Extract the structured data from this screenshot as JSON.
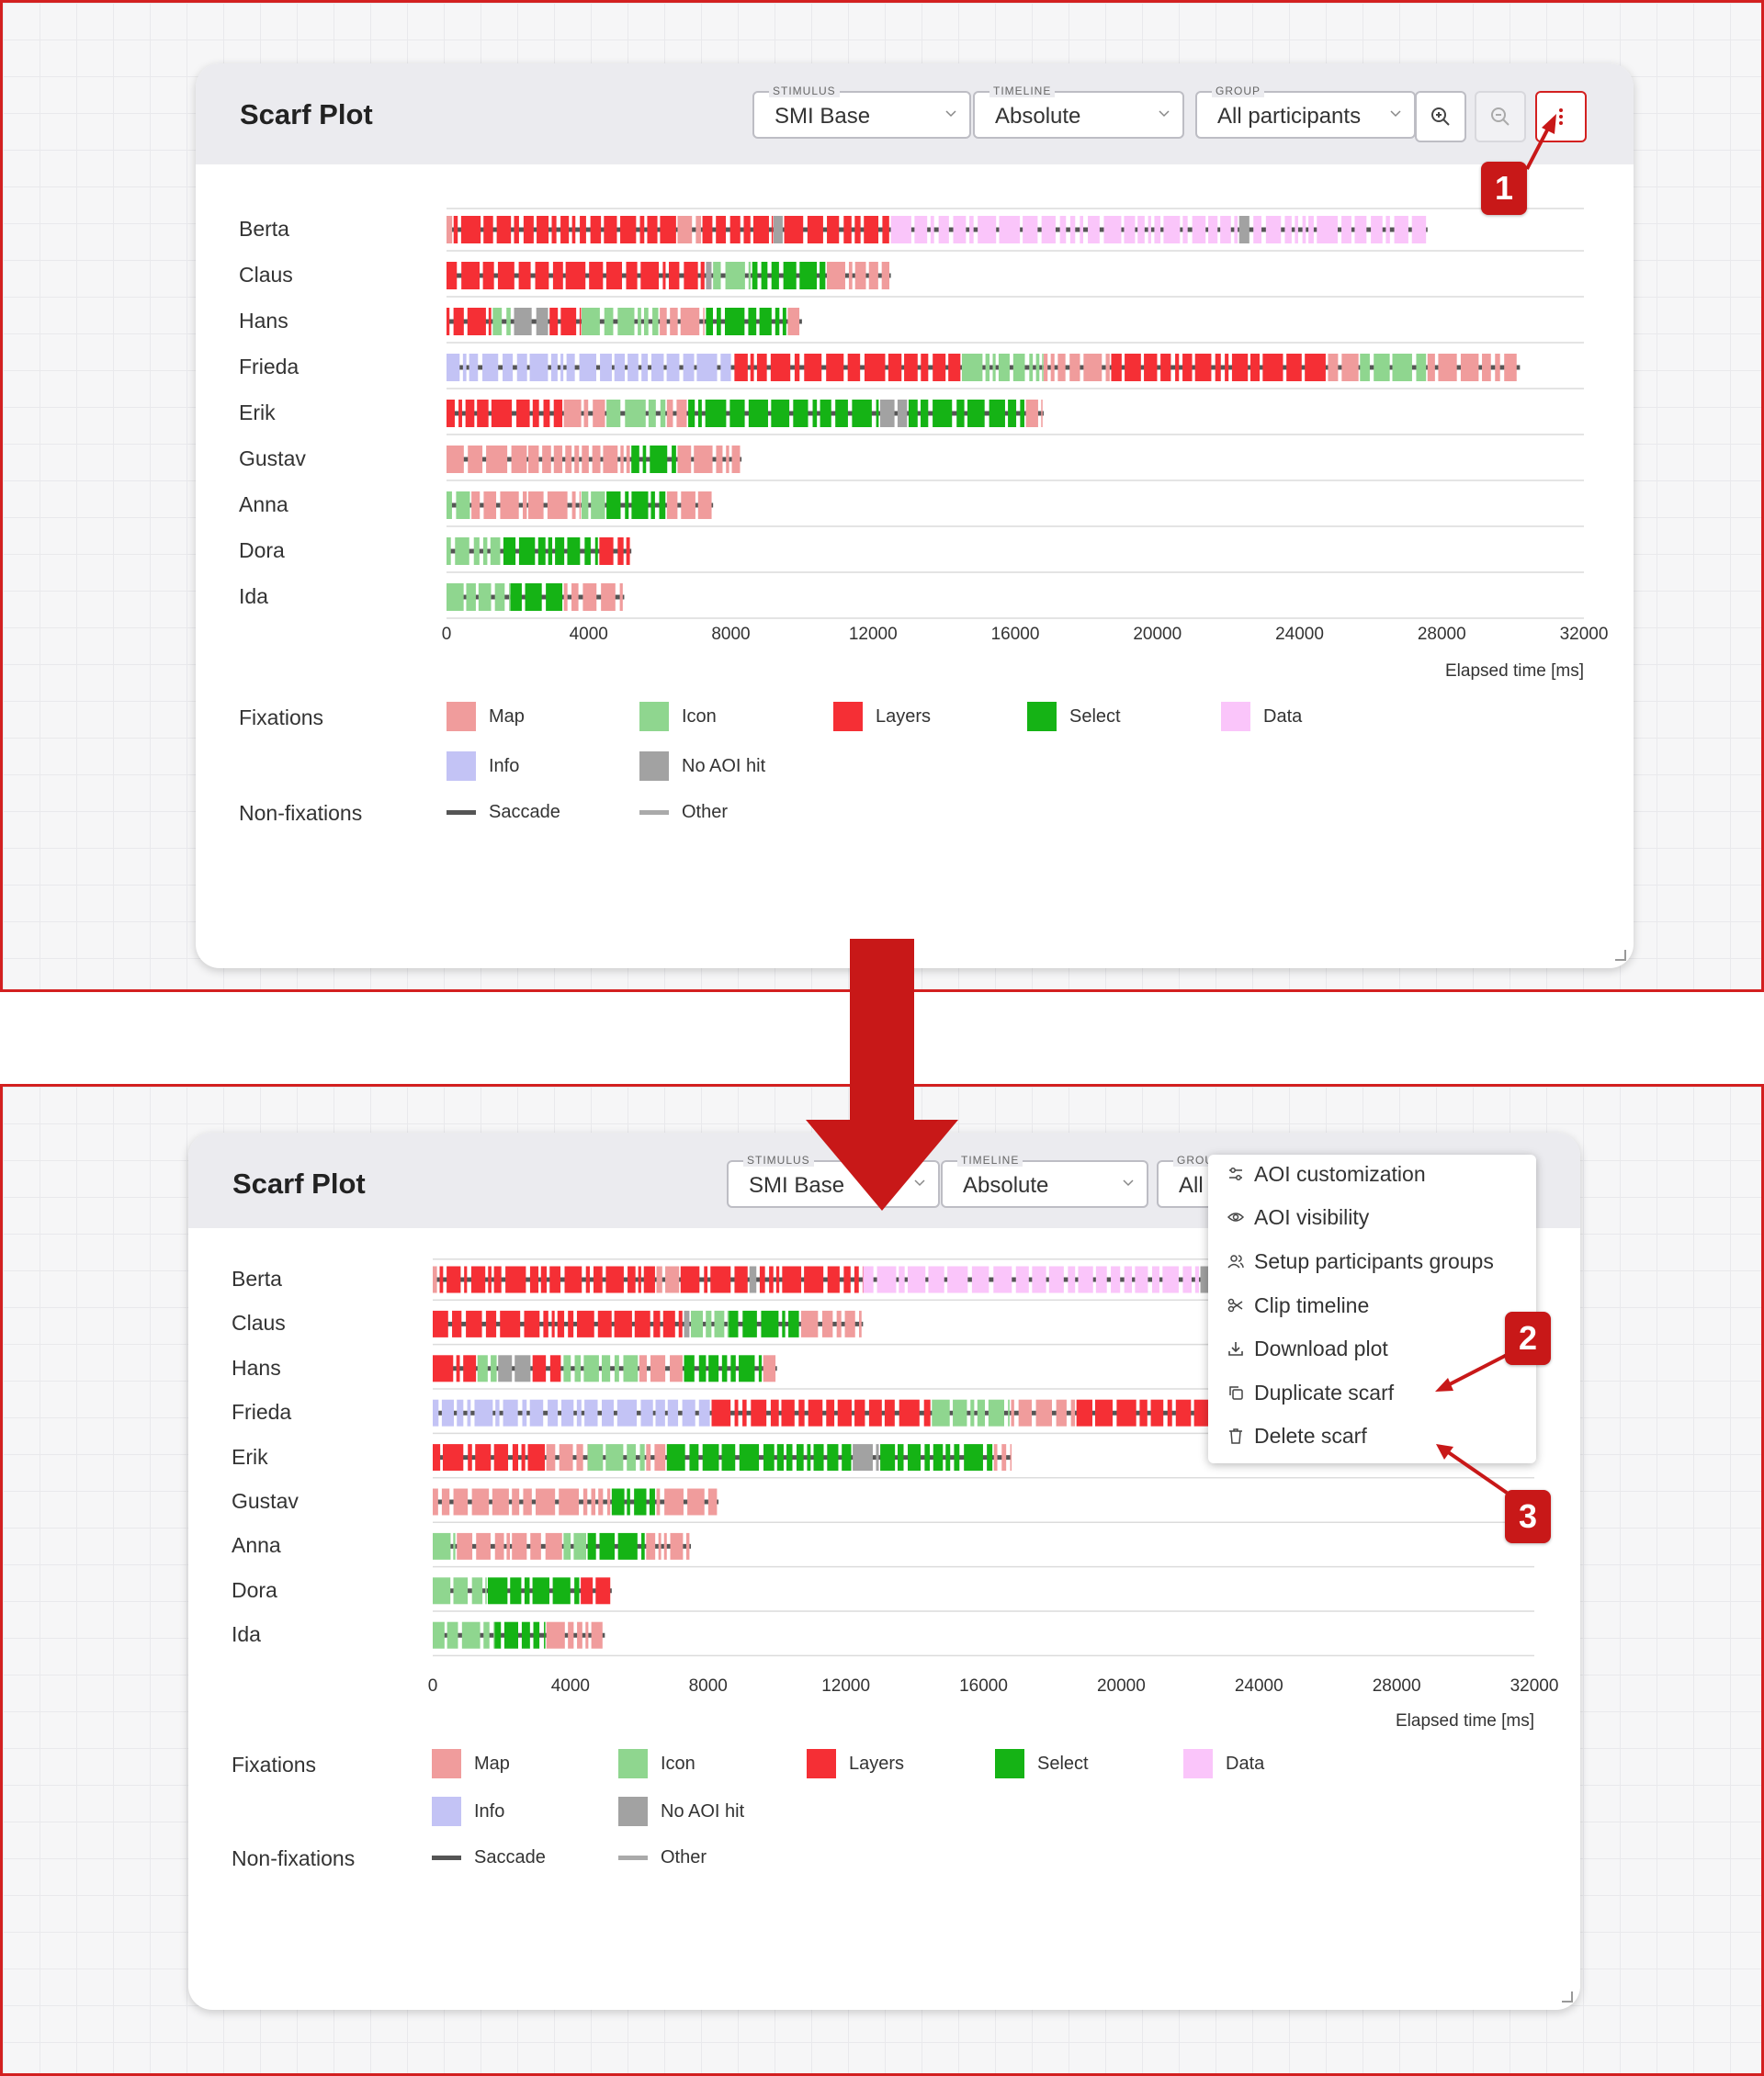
{
  "panels": [
    {
      "title": "Scarf Plot",
      "stimulus": {
        "label": "STIMULUS",
        "value": "SMI Base"
      },
      "timeline": {
        "label": "TIMELINE",
        "value": "Absolute"
      },
      "group": {
        "label": "GROUP",
        "value": "All participants"
      }
    },
    {
      "title": "Scarf Plot",
      "stimulus": {
        "label": "STIMULUS",
        "value": "SMI Base"
      },
      "timeline": {
        "label": "TIMELINE",
        "value": "Absolute"
      },
      "group": {
        "label": "GROUP",
        "value": "All"
      }
    }
  ],
  "menu": {
    "items": [
      {
        "label": "AOI customization",
        "icon": "sliders-icon"
      },
      {
        "label": "AOI visibility",
        "icon": "eye-icon"
      },
      {
        "label": "Setup participants groups",
        "icon": "users-icon"
      },
      {
        "label": "Clip timeline",
        "icon": "scissors-icon"
      },
      {
        "label": "Download plot",
        "icon": "download-icon"
      },
      {
        "label": "Duplicate scarf",
        "icon": "copy-icon"
      },
      {
        "label": "Delete scarf",
        "icon": "trash-icon"
      }
    ]
  },
  "annotations": [
    "1",
    "2",
    "3"
  ],
  "colors": {
    "Map": "#f09c9c",
    "Icon": "#8fd68f",
    "Layers": "#f52f35",
    "Select": "#15b315",
    "Data": "#fac5fa",
    "Info": "#c3c3f5",
    "No AOI hit": "#a2a2a2",
    "Saccade": "#555555",
    "Other": "#aaaaaa",
    "annotation": "#c81818"
  },
  "chart_data": {
    "type": "scarf",
    "xlabel": "Elapsed time [ms]",
    "xlim": [
      0,
      32000
    ],
    "xticks": [
      0,
      4000,
      8000,
      12000,
      16000,
      20000,
      24000,
      28000,
      32000
    ],
    "participants": [
      {
        "name": "Berta",
        "segments": [
          {
            "aoi": "Map",
            "start": 0,
            "end": 200
          },
          {
            "aoi": "Layers",
            "start": 200,
            "end": 6500
          },
          {
            "aoi": "Map",
            "start": 6500,
            "end": 7200
          },
          {
            "aoi": "Layers",
            "start": 7200,
            "end": 9200
          },
          {
            "aoi": "No AOI hit",
            "start": 9200,
            "end": 9500
          },
          {
            "aoi": "Layers",
            "start": 9500,
            "end": 12500
          },
          {
            "aoi": "Data",
            "start": 12500,
            "end": 22300
          },
          {
            "aoi": "No AOI hit",
            "start": 22300,
            "end": 22700
          },
          {
            "aoi": "Data",
            "start": 22700,
            "end": 27600
          }
        ]
      },
      {
        "name": "Claus",
        "segments": [
          {
            "aoi": "Layers",
            "start": 0,
            "end": 7300
          },
          {
            "aoi": "No AOI hit",
            "start": 7300,
            "end": 7500
          },
          {
            "aoi": "Icon",
            "start": 7500,
            "end": 8600
          },
          {
            "aoi": "Select",
            "start": 8600,
            "end": 10700
          },
          {
            "aoi": "Map",
            "start": 10700,
            "end": 12500
          }
        ]
      },
      {
        "name": "Hans",
        "segments": [
          {
            "aoi": "Layers",
            "start": 0,
            "end": 1300
          },
          {
            "aoi": "Icon",
            "start": 1300,
            "end": 1900
          },
          {
            "aoi": "No AOI hit",
            "start": 1900,
            "end": 2900
          },
          {
            "aoi": "Layers",
            "start": 2900,
            "end": 3800
          },
          {
            "aoi": "Icon",
            "start": 3800,
            "end": 6000
          },
          {
            "aoi": "Map",
            "start": 6000,
            "end": 7300
          },
          {
            "aoi": "Select",
            "start": 7300,
            "end": 9600
          },
          {
            "aoi": "Map",
            "start": 9600,
            "end": 10000
          }
        ]
      },
      {
        "name": "Frieda",
        "segments": [
          {
            "aoi": "Info",
            "start": 0,
            "end": 8100
          },
          {
            "aoi": "Layers",
            "start": 8100,
            "end": 14500
          },
          {
            "aoi": "Icon",
            "start": 14500,
            "end": 16800
          },
          {
            "aoi": "Map",
            "start": 16800,
            "end": 18700
          },
          {
            "aoi": "Layers",
            "start": 18700,
            "end": 24800
          },
          {
            "aoi": "Map",
            "start": 24800,
            "end": 25700
          },
          {
            "aoi": "Icon",
            "start": 25700,
            "end": 27600
          },
          {
            "aoi": "Map",
            "start": 27600,
            "end": 30200
          }
        ]
      },
      {
        "name": "Erik",
        "segments": [
          {
            "aoi": "Layers",
            "start": 0,
            "end": 3300
          },
          {
            "aoi": "Map",
            "start": 3300,
            "end": 4500
          },
          {
            "aoi": "Icon",
            "start": 4500,
            "end": 6200
          },
          {
            "aoi": "Map",
            "start": 6200,
            "end": 6800
          },
          {
            "aoi": "Select",
            "start": 6800,
            "end": 12200
          },
          {
            "aoi": "No AOI hit",
            "start": 12200,
            "end": 13000
          },
          {
            "aoi": "Select",
            "start": 13000,
            "end": 16300
          },
          {
            "aoi": "Map",
            "start": 16300,
            "end": 16800
          }
        ]
      },
      {
        "name": "Gustav",
        "segments": [
          {
            "aoi": "Map",
            "start": 0,
            "end": 2300
          },
          {
            "aoi": "Map",
            "start": 2300,
            "end": 5200
          },
          {
            "aoi": "Select",
            "start": 5200,
            "end": 6500
          },
          {
            "aoi": "Map",
            "start": 6500,
            "end": 8300
          }
        ]
      },
      {
        "name": "Anna",
        "segments": [
          {
            "aoi": "Icon",
            "start": 0,
            "end": 700
          },
          {
            "aoi": "Map",
            "start": 700,
            "end": 2300
          },
          {
            "aoi": "Map",
            "start": 2300,
            "end": 3800
          },
          {
            "aoi": "Icon",
            "start": 3800,
            "end": 4500
          },
          {
            "aoi": "Select",
            "start": 4500,
            "end": 6200
          },
          {
            "aoi": "Map",
            "start": 6200,
            "end": 7500
          }
        ]
      },
      {
        "name": "Dora",
        "segments": [
          {
            "aoi": "Icon",
            "start": 0,
            "end": 1600
          },
          {
            "aoi": "Select",
            "start": 1600,
            "end": 4300
          },
          {
            "aoi": "Layers",
            "start": 4300,
            "end": 5200
          }
        ]
      },
      {
        "name": "Ida",
        "segments": [
          {
            "aoi": "Icon",
            "start": 0,
            "end": 1800
          },
          {
            "aoi": "Select",
            "start": 1800,
            "end": 3300
          },
          {
            "aoi": "Map",
            "start": 3300,
            "end": 5000
          }
        ]
      }
    ],
    "legend": {
      "fixations_label": "Fixations",
      "non_fixations_label": "Non-fixations",
      "fixations": [
        "Map",
        "Icon",
        "Layers",
        "Select",
        "Data",
        "Info",
        "No AOI hit"
      ],
      "non_fixations": [
        "Saccade",
        "Other"
      ]
    }
  }
}
